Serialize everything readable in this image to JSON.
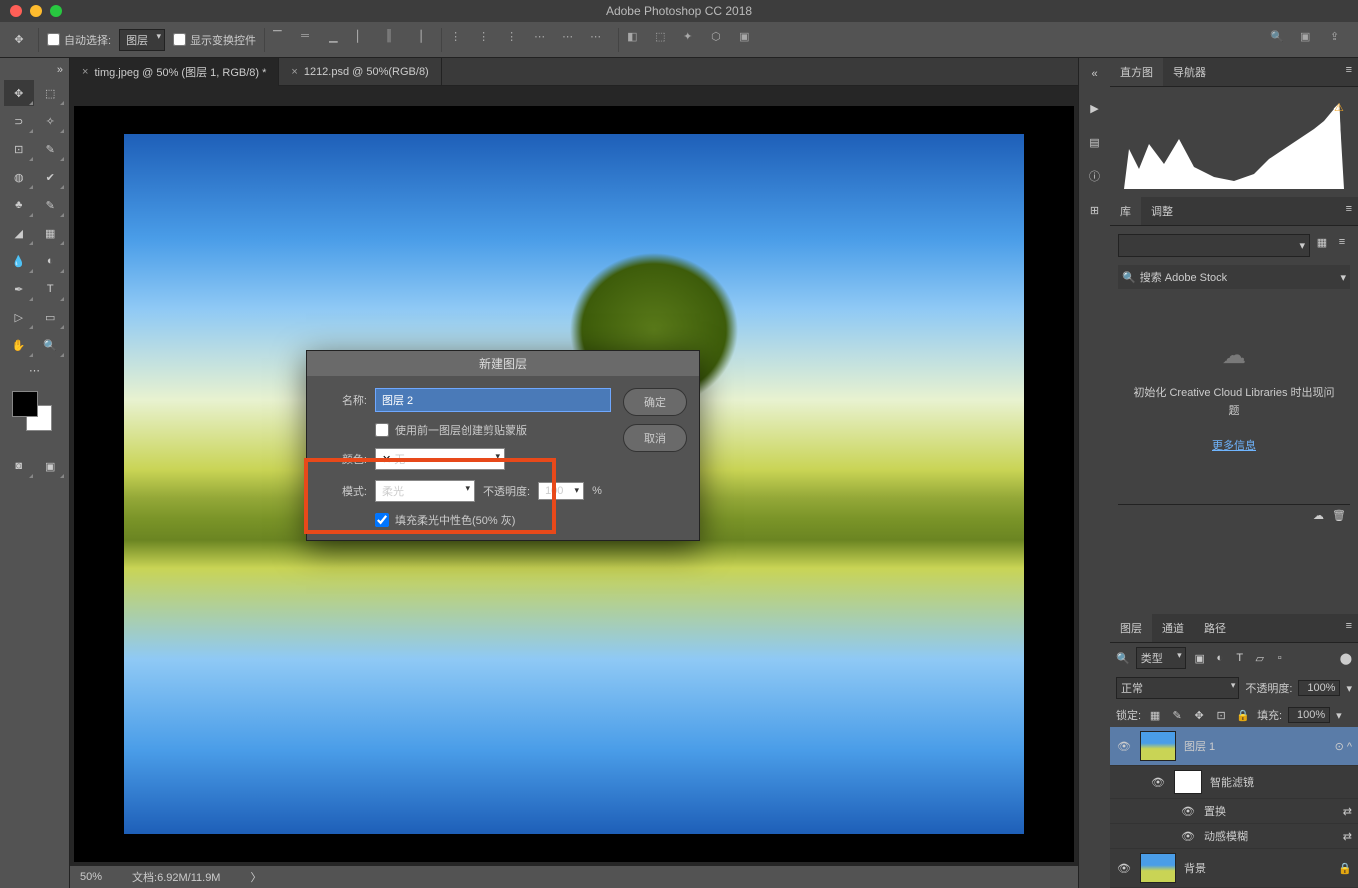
{
  "app": {
    "title": "Adobe Photoshop CC 2018"
  },
  "options": {
    "auto_select": "自动选择:",
    "layer_select": "图层",
    "show_controls": "显示变换控件"
  },
  "tabs": [
    {
      "label": "timg.jpeg @ 50% (图层 1, RGB/8) *",
      "active": true
    },
    {
      "label": "1212.psd @ 50%(RGB/8)",
      "active": false
    }
  ],
  "status": {
    "zoom": "50%",
    "doc": "文档:6.92M/11.9M"
  },
  "panels": {
    "histogram": {
      "tab1": "直方图",
      "tab2": "导航器"
    },
    "library": {
      "tab1": "库",
      "tab2": "调整",
      "search_placeholder": "搜索 Adobe Stock",
      "empty_msg": "初始化 Creative Cloud Libraries 时出现问题",
      "more_info": "更多信息"
    },
    "layers": {
      "tab1": "图层",
      "tab2": "通道",
      "tab3": "路径",
      "kind_label": "类型",
      "mode": "正常",
      "opacity_label": "不透明度:",
      "opacity": "100%",
      "lock_label": "锁定:",
      "fill_label": "填充:",
      "fill": "100%",
      "items": [
        {
          "name": "图层 1",
          "smart": "智能滤镜",
          "filter1": "置换",
          "filter2": "动感模糊"
        },
        {
          "name": "背景"
        }
      ]
    }
  },
  "dialog": {
    "title": "新建图层",
    "name_label": "名称:",
    "name_value": "图层 2",
    "clip_label": "使用前一图层创建剪贴蒙版",
    "color_label": "颜色:",
    "color_value": "无",
    "mode_label": "模式:",
    "mode_value": "柔光",
    "opacity_label": "不透明度:",
    "opacity_value": "100",
    "opacity_unit": "%",
    "neutral_label": "填充柔光中性色(50% 灰)",
    "ok": "确定",
    "cancel": "取消"
  }
}
